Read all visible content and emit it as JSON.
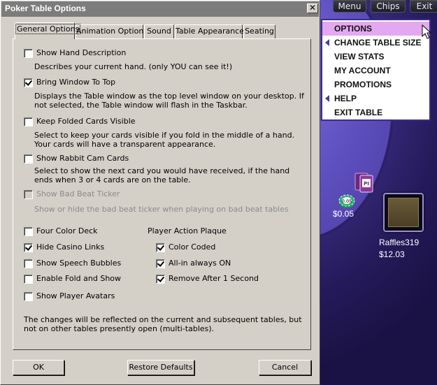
{
  "window": {
    "title": "Poker Table Options",
    "close_label": "✕"
  },
  "tabs": [
    {
      "label": "General Options",
      "active": true
    },
    {
      "label": "Animation Options",
      "active": false
    },
    {
      "label": "Sound",
      "active": false
    },
    {
      "label": "Table Appearance",
      "active": false
    },
    {
      "label": "Seating",
      "active": false
    }
  ],
  "options": {
    "show_hand_description": {
      "label": "Show Hand Description",
      "checked": false,
      "desc": "Describes your current hand. (only YOU can see it!)"
    },
    "bring_window_to_top": {
      "label": "Bring Window To Top",
      "checked": true,
      "desc1": "Displays the Table window as the top level window on your desktop. If",
      "desc2": "not selected, the Table window will flash in the Taskbar."
    },
    "keep_folded_cards": {
      "label": "Keep Folded Cards Visible",
      "checked": false,
      "desc1": "Select to keep your cards visible if you fold in the middle of a hand.",
      "desc2": "Your cards will have a transparent appearance."
    },
    "show_rabbit_cam": {
      "label": "Show Rabbit Cam Cards",
      "checked": false,
      "desc1": "Select to show the next card you would have received, if the hand",
      "desc2": "ends when 3 or 4 cards are on the table."
    },
    "show_bad_beat": {
      "label": "Show Bad Beat Ticker",
      "checked": false,
      "disabled": true,
      "desc": "Show or hide the bad beat ticker when playing on bad beat tables"
    },
    "four_color_deck": {
      "label": "Four Color Deck",
      "checked": false
    },
    "hide_casino_links": {
      "label": "Hide Casino Links",
      "checked": true
    },
    "show_speech_bubbles": {
      "label": "Show Speech Bubbles",
      "checked": false
    },
    "enable_fold_show": {
      "label": "Enable Fold and Show",
      "checked": false
    },
    "show_player_avatars": {
      "label": "Show Player Avatars",
      "checked": false
    }
  },
  "plaque": {
    "heading": "Player Action Plaque",
    "color_coded": {
      "label": "Color Coded",
      "checked": true
    },
    "all_in": {
      "label": "All-in always ON",
      "checked": true
    },
    "remove_after": {
      "label": "Remove After 1 Second",
      "checked": true
    }
  },
  "note": {
    "line1": "The changes will be reflected on the current and subsequent tables, but",
    "line2": "not on other tables presently open (multi-tables)."
  },
  "buttons": {
    "ok": "OK",
    "restore": "Restore Defaults",
    "cancel": "Cancel"
  },
  "top_nav": {
    "menu": "Menu",
    "chips": "Chips",
    "exit": "Exit"
  },
  "menu_items": [
    {
      "label": "OPTIONS",
      "active": true,
      "arrow": false
    },
    {
      "label": "CHANGE TABLE SIZE",
      "active": false,
      "arrow": true
    },
    {
      "label": "VIEW STATS",
      "active": false,
      "arrow": false
    },
    {
      "label": "MY ACCOUNT",
      "active": false,
      "arrow": false
    },
    {
      "label": "PROMOTIONS",
      "active": false,
      "arrow": false
    },
    {
      "label": "HELP",
      "active": false,
      "arrow": true
    },
    {
      "label": "EXIT TABLE",
      "active": false,
      "arrow": false
    }
  ],
  "table": {
    "chip_label": "0.05",
    "pot": "$0.05",
    "card_label": "PI",
    "player_name": "Raffles319",
    "player_stack": "$12.03"
  },
  "colors": {
    "menu_highlight": "#e4a8f0",
    "felt": "#5f50c0",
    "dialog_bg": "#d4d0c8",
    "titlebar": "#7c7c7c"
  }
}
